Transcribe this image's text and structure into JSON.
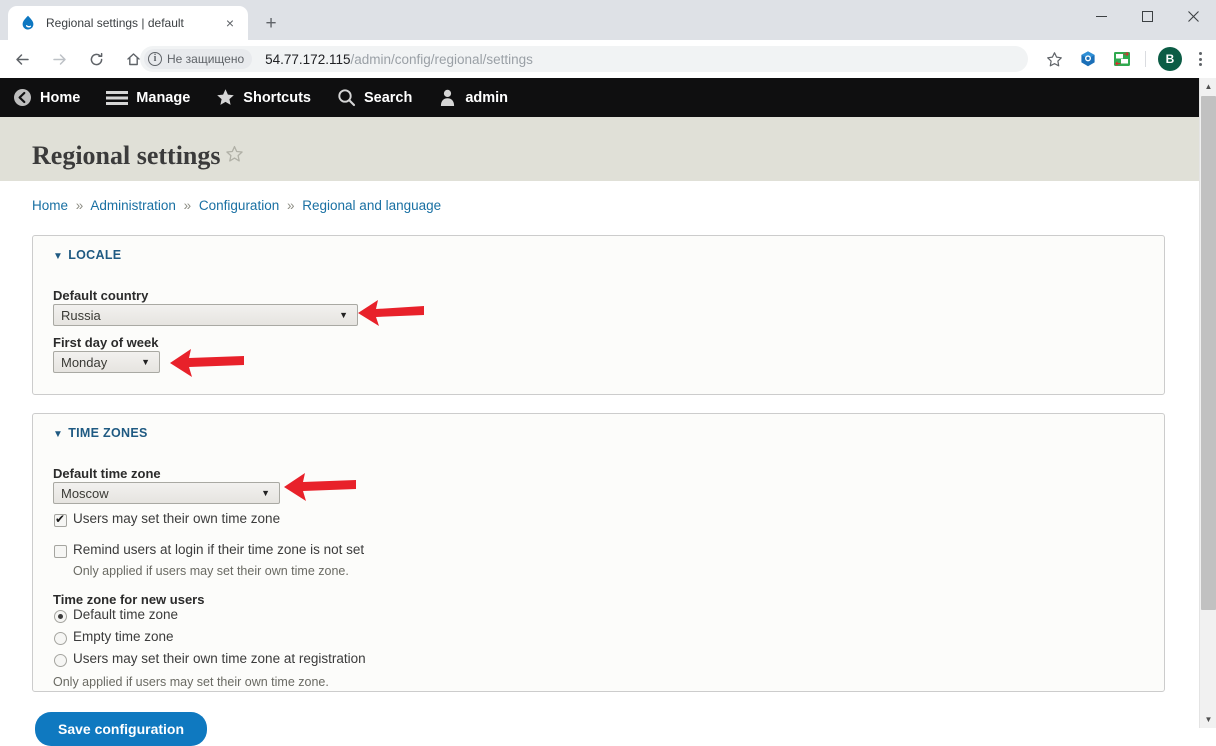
{
  "browser": {
    "tab": {
      "title": "Regional settings | default",
      "favicon": "drupal-drop-icon",
      "close": "×"
    },
    "new_tab": "+",
    "window_controls": {
      "minimize": "—",
      "maximize": "☐",
      "close": "✕"
    },
    "nav": {
      "back": "←",
      "forward": "→",
      "reload": "⟳",
      "home": "⌂"
    },
    "omnibox": {
      "security_label": "Не защищено",
      "info_glyph": "i",
      "url_host": "54.77.172.115",
      "url_path": "/admin/config/regional/settings"
    },
    "actions": {
      "bookmark": "☆",
      "extension_1": "shield-extension-icon",
      "extension_2": "translate-extension-icon",
      "profile_initial": "B",
      "menu": "chrome-menu-icon"
    }
  },
  "admin_toolbar": {
    "items": [
      {
        "label": "Home",
        "icon": "back-circle-icon"
      },
      {
        "label": "Manage",
        "icon": "hamburger-icon"
      },
      {
        "label": "Shortcuts",
        "icon": "star-icon"
      },
      {
        "label": "Search",
        "icon": "magnifier-icon"
      },
      {
        "label": "admin",
        "icon": "user-icon"
      }
    ]
  },
  "page": {
    "title": "Regional settings",
    "star": "☆",
    "breadcrumb": [
      {
        "label": "Home"
      },
      {
        "label": "Administration"
      },
      {
        "label": "Configuration"
      },
      {
        "label": "Regional and language"
      }
    ],
    "breadcrumb_separator": "»"
  },
  "locale": {
    "legend": "LOCALE",
    "caret": "▼",
    "country": {
      "label": "Default country",
      "value": "Russia",
      "arrow": "▼"
    },
    "first_day": {
      "label": "First day of week",
      "value": "Monday",
      "arrow": "▼"
    }
  },
  "time_zones": {
    "legend": "TIME ZONES",
    "caret": "▼",
    "default_tz": {
      "label": "Default time zone",
      "value": "Moscow",
      "arrow": "▼"
    },
    "users_own_tz": {
      "label": "Users may set their own time zone",
      "checked": true
    },
    "remind_users": {
      "label": "Remind users at login if their time zone is not set",
      "description": "Only applied if users may set their own time zone.",
      "checked": false
    },
    "new_users": {
      "label": "Time zone for new users",
      "description": "Only applied if users may set their own time zone.",
      "options": [
        {
          "label": "Default time zone",
          "selected": true
        },
        {
          "label": "Empty time zone",
          "selected": false
        },
        {
          "label": "Users may set their own time zone at registration",
          "selected": false
        }
      ]
    }
  },
  "form": {
    "save_label": "Save configuration"
  },
  "annotations": {
    "color": "#e8212a",
    "arrows": [
      {
        "name": "arrow-to-default-country"
      },
      {
        "name": "arrow-to-first-day-of-week"
      },
      {
        "name": "arrow-to-default-time-zone"
      }
    ]
  },
  "scrollbar": {
    "up": "▲",
    "down": "▼"
  }
}
